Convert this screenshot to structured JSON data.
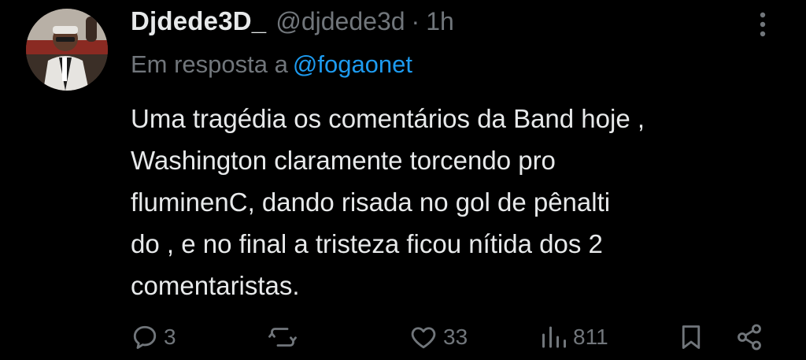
{
  "author": {
    "display_name": "Djdede3D_",
    "handle": "@djdede3d",
    "separator": "·",
    "time": "1h"
  },
  "reply_context": {
    "prefix": "Em resposta a",
    "mention": "@fogaonet"
  },
  "body": {
    "text": "Uma tragédia os comentários da Band hoje ,\nWashington claramente torcendo pro\nfluminenC, dando risada no gol de pênalti\ndo , e no final a tristeza ficou nítida dos 2\ncomentaristas."
  },
  "actions": {
    "replies": "3",
    "reposts": "",
    "likes": "33",
    "views": "811"
  },
  "icons": {
    "reply": "reply-icon",
    "repost": "repost-icon",
    "like": "heart-icon",
    "views": "views-icon",
    "bookmark": "bookmark-icon",
    "share": "share-icon",
    "more": "more-vertical-icon"
  },
  "colors": {
    "background": "#000000",
    "text": "#e7e9ea",
    "muted": "#71767b",
    "link": "#1d9bf0"
  }
}
